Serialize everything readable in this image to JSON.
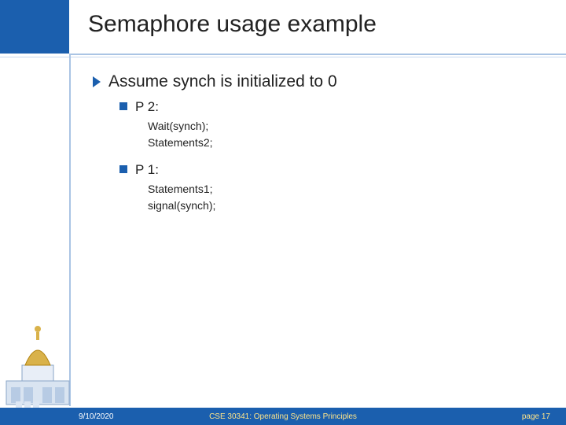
{
  "title": "Semaphore usage example",
  "bullet1": "Assume synch is initialized to 0",
  "p2": {
    "label": "P 2:",
    "lines": [
      "Wait(synch);",
      "Statements2;"
    ]
  },
  "p1": {
    "label": "P 1:",
    "lines": [
      "Statements1;",
      "signal(synch);"
    ]
  },
  "footer": {
    "date": "9/10/2020",
    "course": "CSE 30341: Operating Systems Principles",
    "page": "page 17"
  }
}
